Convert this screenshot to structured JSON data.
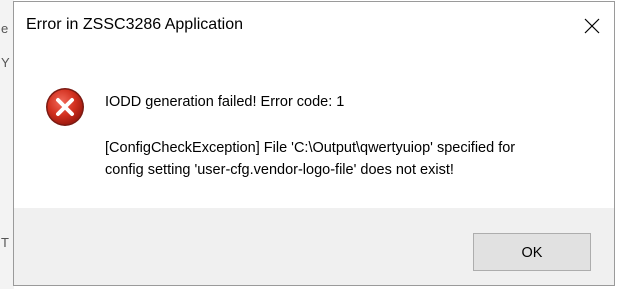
{
  "window": {
    "title": "Error in ZSSC3286 Application",
    "close_icon": "close-icon"
  },
  "background": {
    "glyphs": [
      "e",
      "Y",
      "T"
    ]
  },
  "message": {
    "icon": "error-icon",
    "icon_color": "#c42b1c",
    "main": "IODD generation failed! Error code: 1",
    "detail_line1": "[ConfigCheckException] File 'C:\\Output\\qwertyuiop' specified for",
    "detail_line2": "config setting 'user-cfg.vendor-logo-file' does not exist!"
  },
  "buttons": {
    "ok_label": "OK"
  }
}
